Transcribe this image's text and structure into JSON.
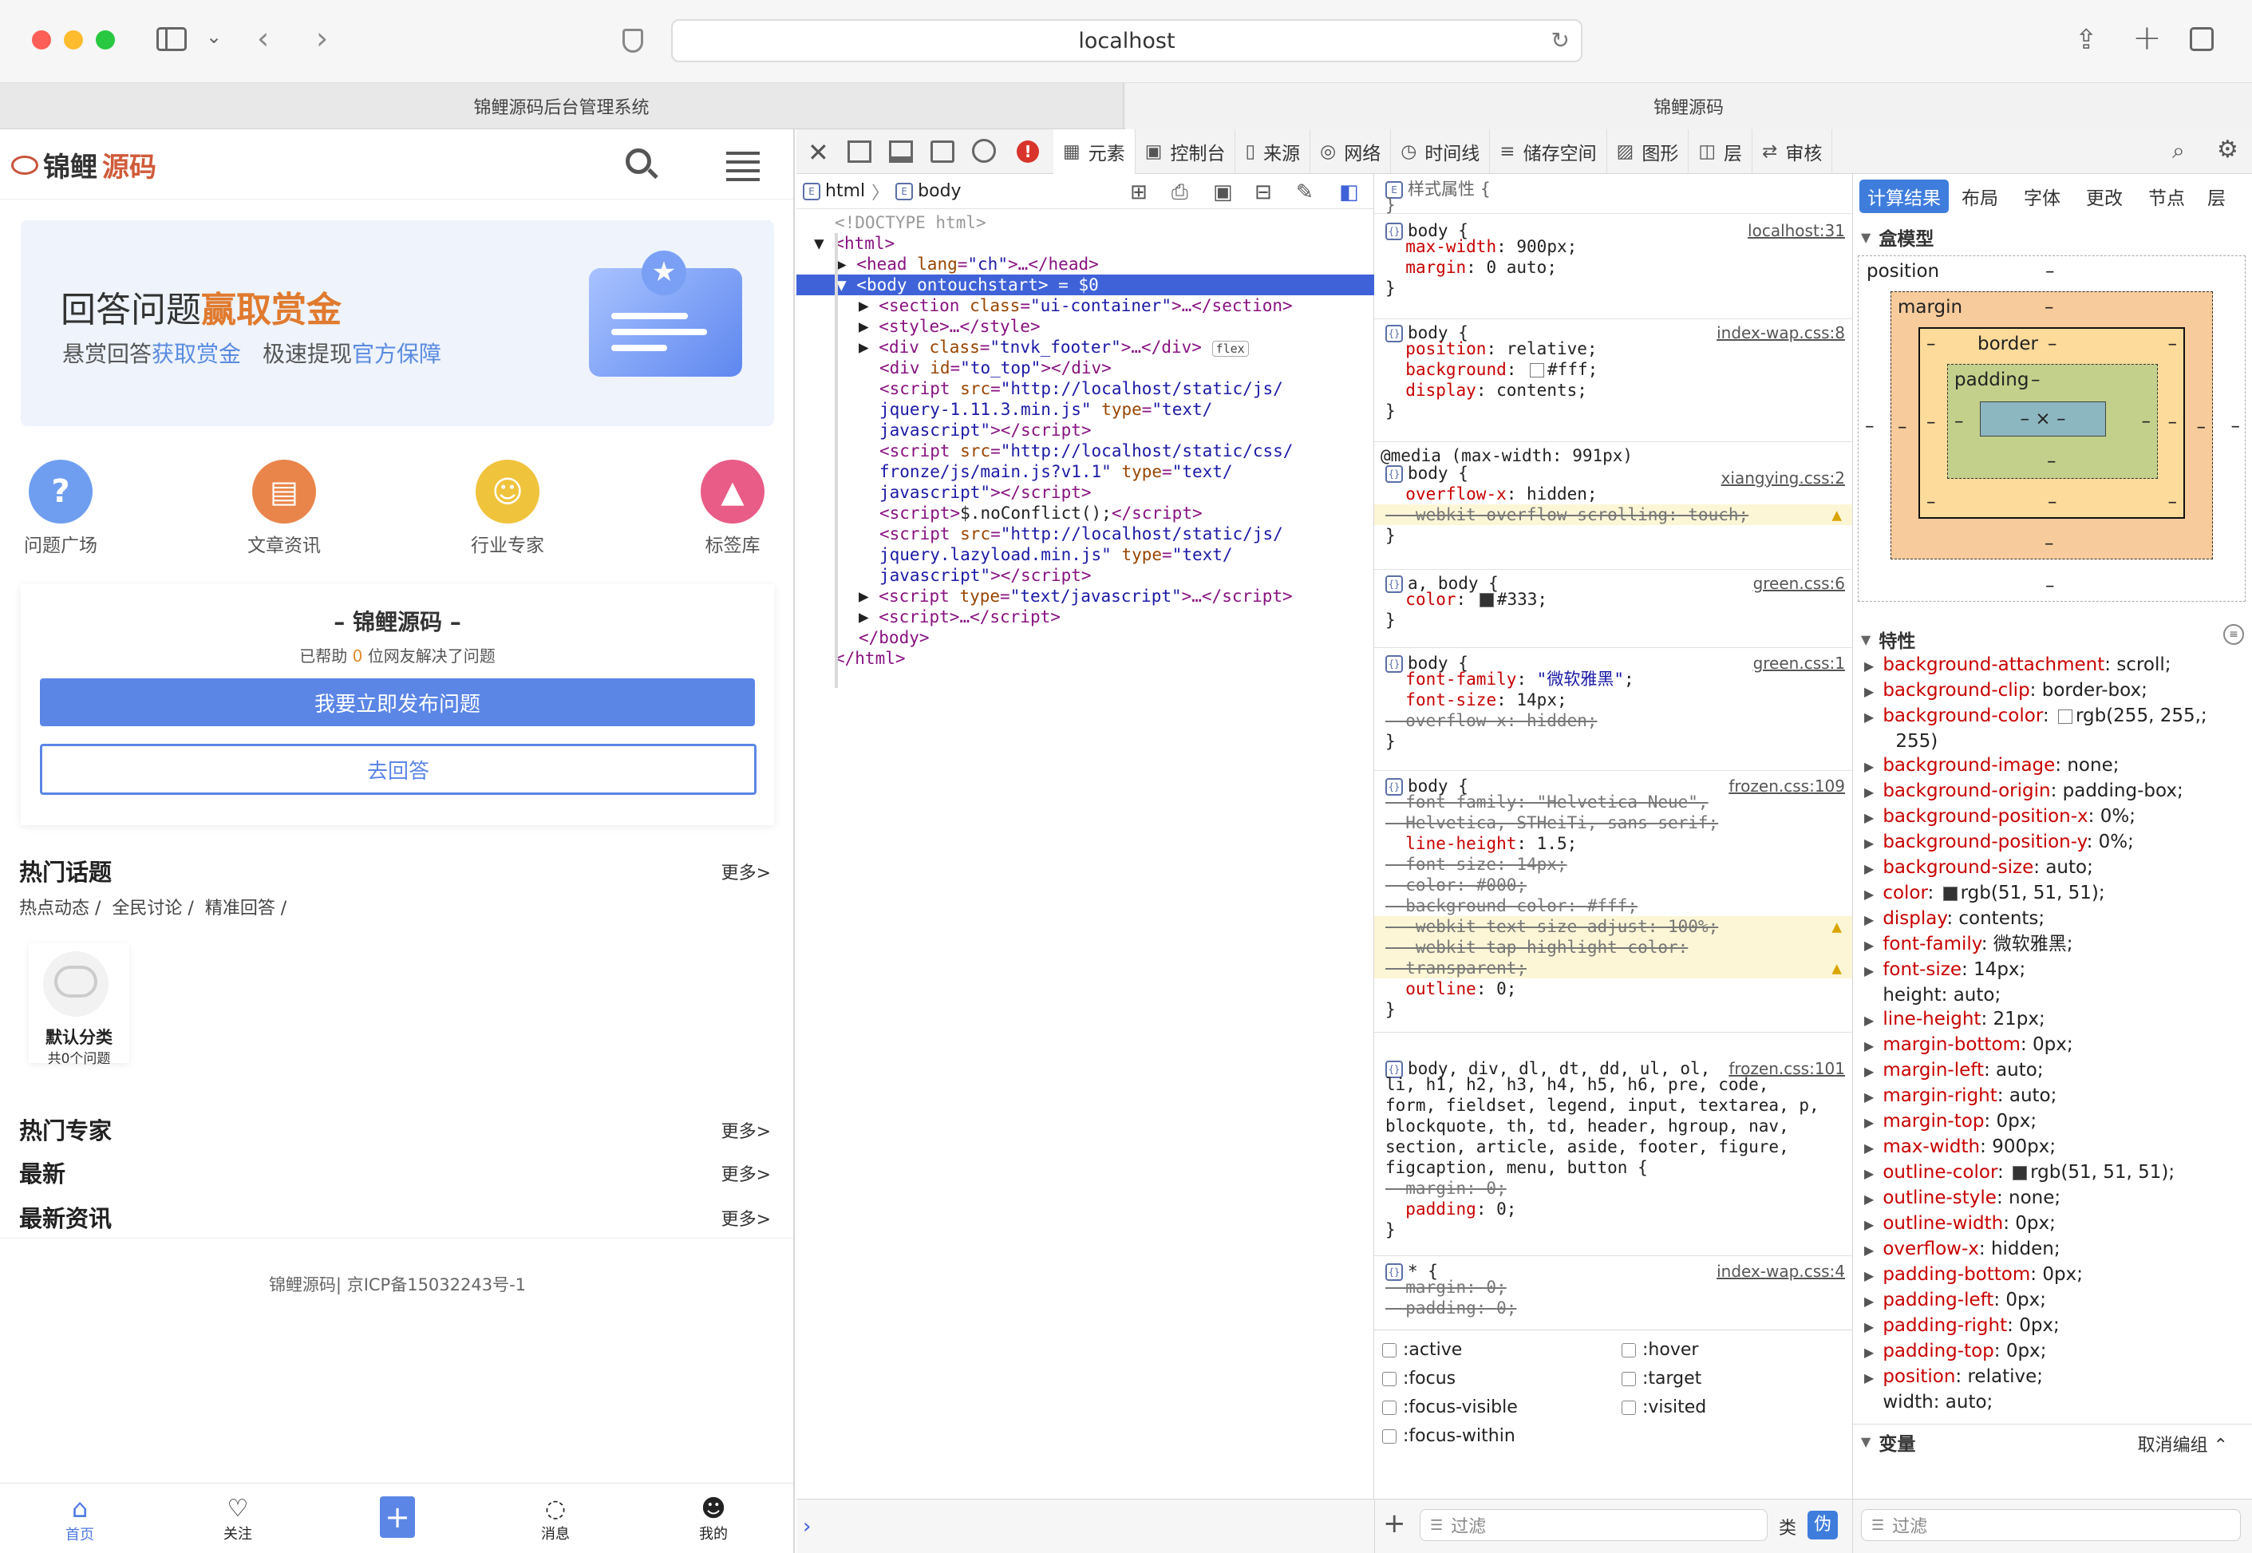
{
  "browser": {
    "url": "localhost",
    "tabs": [
      "锦鲤源码后台管理系统",
      "锦鲤源码"
    ]
  },
  "mobile": {
    "logo": {
      "part1": "锦鲤",
      "part2": "源码"
    },
    "banner": {
      "title_plain": "回答问题",
      "title_highlight": "赢取赏金",
      "sub1": "悬赏回答",
      "sub1_link": "获取赏金",
      "sub2": "极速提现",
      "sub2_link": "官方保障"
    },
    "quicklinks": [
      {
        "label": "问题广场",
        "color": "#6f9ef0",
        "icon": "question-icon"
      },
      {
        "label": "文章资讯",
        "color": "#e9854a",
        "icon": "article-icon"
      },
      {
        "label": "行业专家",
        "color": "#f0c33c",
        "icon": "people-icon"
      },
      {
        "label": "标签库",
        "color": "#e95c88",
        "icon": "graduation-cap-icon"
      }
    ],
    "card": {
      "title": "– 锦鲤源码 –",
      "helped_pre": "已帮助",
      "helped_count": "0",
      "helped_post": "位网友解决了问题",
      "publish_btn": "我要立即发布问题",
      "answer_btn": "去回答"
    },
    "hot_topics": {
      "title": "热门话题",
      "more": "更多>",
      "tags": [
        "热点动态 /",
        "全民讨论 /",
        "精准回答 /"
      ],
      "category": {
        "name": "默认分类",
        "count": "共0个问题"
      }
    },
    "sections": [
      {
        "title": "热门专家",
        "more": "更多>"
      },
      {
        "title": "最新",
        "more": "更多>"
      },
      {
        "title": "最新资讯",
        "more": "更多>"
      }
    ],
    "footer": "锦鲤源码| 京ICP备15032243号-1",
    "nav": [
      {
        "label": "首页",
        "icon": "home-icon",
        "active": true
      },
      {
        "label": "关注",
        "icon": "heart-icon"
      },
      {
        "label": "",
        "icon": "plus-icon"
      },
      {
        "label": "消息",
        "icon": "chat-icon"
      },
      {
        "label": "我的",
        "icon": "user-icon"
      }
    ]
  },
  "devtools": {
    "tabs": [
      "元素",
      "控制台",
      "来源",
      "网络",
      "时间线",
      "储存空间",
      "图形",
      "层",
      "审核"
    ],
    "breadcrumb": [
      "html",
      "body"
    ],
    "styles_header": "样式属性",
    "computed_tabs": [
      "计算结果",
      "布局",
      "字体",
      "更改",
      "节点",
      "层"
    ],
    "boxmodel": {
      "title": "盒模型",
      "position": "position",
      "margin": "margin",
      "border": "border",
      "padding": "padding",
      "content": "– × –",
      "dash": "–"
    },
    "props_title": "特性",
    "props": [
      [
        "background-attachment",
        "scroll"
      ],
      [
        "background-clip",
        "border-box"
      ],
      [
        "background-color",
        "rgb(255, 255,"
      ],
      [
        "",
        "255)"
      ],
      [
        "background-image",
        "none"
      ],
      [
        "background-origin",
        "padding-box"
      ],
      [
        "background-position-x",
        "0%"
      ],
      [
        "background-position-y",
        "0%"
      ],
      [
        "background-size",
        "auto"
      ],
      [
        "color",
        "rgb(51, 51, 51)"
      ],
      [
        "display",
        "contents"
      ],
      [
        "font-family",
        "微软雅黑"
      ],
      [
        "font-size",
        "14px"
      ],
      [
        "height",
        "auto"
      ],
      [
        "line-height",
        "21px"
      ],
      [
        "margin-bottom",
        "0px"
      ],
      [
        "margin-left",
        "auto"
      ],
      [
        "margin-right",
        "auto"
      ],
      [
        "margin-top",
        "0px"
      ],
      [
        "max-width",
        "900px"
      ],
      [
        "outline-color",
        "rgb(51, 51, 51)"
      ],
      [
        "outline-style",
        "none"
      ],
      [
        "outline-width",
        "0px"
      ],
      [
        "overflow-x",
        "hidden"
      ],
      [
        "padding-bottom",
        "0px"
      ],
      [
        "padding-left",
        "0px"
      ],
      [
        "padding-right",
        "0px"
      ],
      [
        "padding-top",
        "0px"
      ],
      [
        "position",
        "relative"
      ],
      [
        "width",
        "auto"
      ]
    ],
    "vars_title": "变量",
    "vars_toggle": "取消编组 ⌃",
    "pseudo": [
      ":active",
      ":hover",
      ":focus",
      ":target",
      ":focus-visible",
      ":visited",
      ":focus-within"
    ],
    "filter_placeholder": "过滤",
    "class_label": "类",
    "pseudo_label": "伪"
  }
}
